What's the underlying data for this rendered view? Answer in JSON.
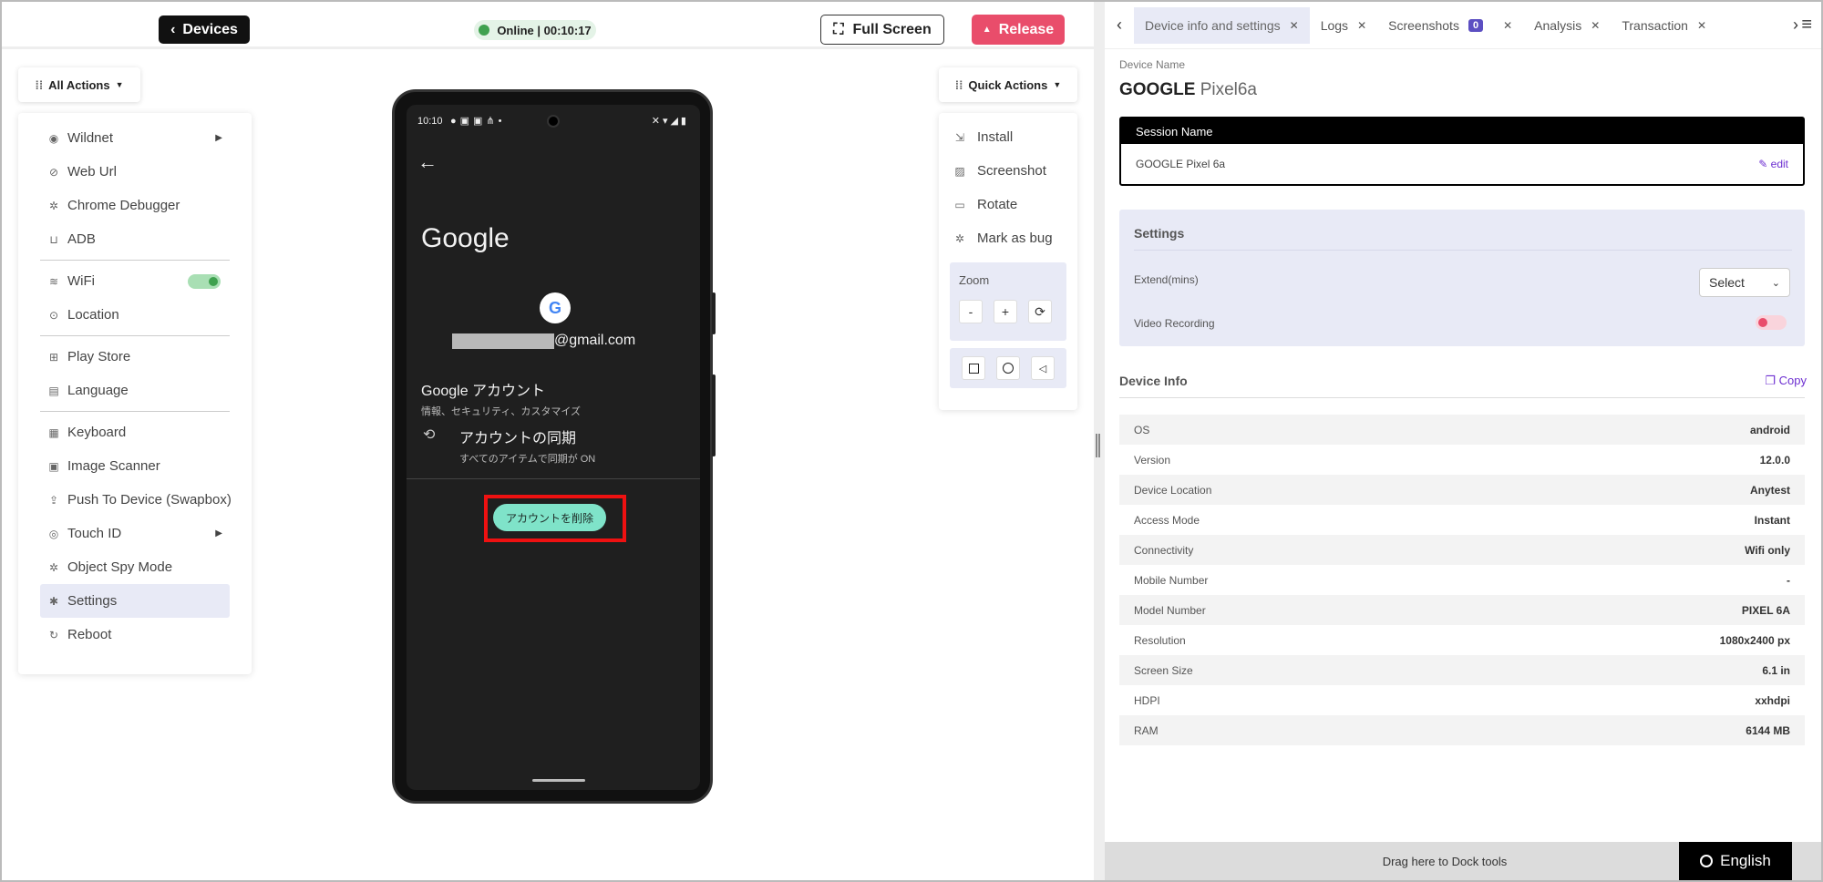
{
  "toolbar": {
    "devices_label": "Devices",
    "online_status": "Online | 00:10:17",
    "fullscreen_label": "Full Screen",
    "release_label": "Release"
  },
  "all_actions": {
    "label": "All Actions",
    "items": [
      {
        "label": "Wildnet",
        "icon": "fingerprint-icon"
      },
      {
        "label": "Web Url",
        "icon": "link-icon"
      },
      {
        "label": "Chrome Debugger",
        "icon": "bug-icon"
      },
      {
        "label": "ADB",
        "icon": "adb-icon"
      },
      {
        "label": "WiFi",
        "icon": "wifi-icon"
      },
      {
        "label": "Location",
        "icon": "location-icon"
      },
      {
        "label": "Play Store",
        "icon": "apps-icon"
      },
      {
        "label": "Language",
        "icon": "translate-icon"
      },
      {
        "label": "Keyboard",
        "icon": "keyboard-icon"
      },
      {
        "label": "Image Scanner",
        "icon": "scanner-icon"
      },
      {
        "label": "Push To Device (Swapbox)",
        "icon": "upload-icon"
      },
      {
        "label": "Touch ID",
        "icon": "fingerprint-icon"
      },
      {
        "label": "Object Spy Mode",
        "icon": "spy-icon"
      },
      {
        "label": "Settings",
        "icon": "gear-icon"
      },
      {
        "label": "Reboot",
        "icon": "reboot-icon"
      }
    ]
  },
  "phone": {
    "time": "10:10",
    "title": "Google",
    "email_suffix": "@gmail.com",
    "account_title": "Google アカウント",
    "account_sub": "情報、セキュリティ、カスタマイズ",
    "sync_title": "アカウントの同期",
    "sync_sub": "すべてのアイテムで同期が ON",
    "remove_button": "アカウントを削除"
  },
  "quick_actions": {
    "label": "Quick Actions",
    "items": [
      {
        "label": "Install",
        "icon": "install-icon"
      },
      {
        "label": "Screenshot",
        "icon": "screenshot-icon"
      },
      {
        "label": "Rotate",
        "icon": "rotate-icon"
      },
      {
        "label": "Mark as bug",
        "icon": "bug-icon"
      }
    ],
    "zoom_label": "Zoom",
    "zoom_minus": "-",
    "zoom_plus": "+"
  },
  "tabs": [
    {
      "label": "Device info and settings"
    },
    {
      "label": "Logs"
    },
    {
      "label": "Screenshots",
      "badge": "0"
    },
    {
      "label": "Analysis"
    },
    {
      "label": "Transaction"
    }
  ],
  "device": {
    "name_label": "Device Name",
    "brand": "GOOGLE",
    "model": "Pixel6a"
  },
  "session": {
    "header": "Session Name",
    "value": "GOOGLE Pixel 6a",
    "edit_label": "edit"
  },
  "settings": {
    "title": "Settings",
    "extend_label": "Extend(mins)",
    "extend_value": "Select",
    "video_label": "Video Recording"
  },
  "device_info": {
    "title": "Device Info",
    "copy_label": "Copy",
    "rows": [
      {
        "k": "OS",
        "v": "android"
      },
      {
        "k": "Version",
        "v": "12.0.0"
      },
      {
        "k": "Device Location",
        "v": "Anytest"
      },
      {
        "k": "Access Mode",
        "v": "Instant"
      },
      {
        "k": "Connectivity",
        "v": "Wifi only"
      },
      {
        "k": "Mobile Number",
        "v": "-"
      },
      {
        "k": "Model Number",
        "v": "PIXEL 6A"
      },
      {
        "k": "Resolution",
        "v": "1080x2400 px"
      },
      {
        "k": "Screen Size",
        "v": "6.1 in"
      },
      {
        "k": "HDPI",
        "v": "xxhdpi"
      },
      {
        "k": "RAM",
        "v": "6144 MB"
      }
    ]
  },
  "dock": {
    "label": "Drag here to Dock tools",
    "language": "English"
  },
  "colors": {
    "release": "#e94d6b",
    "online": "#3fa14f",
    "accent": "#6d2fd1",
    "highlight": "#e11111"
  }
}
